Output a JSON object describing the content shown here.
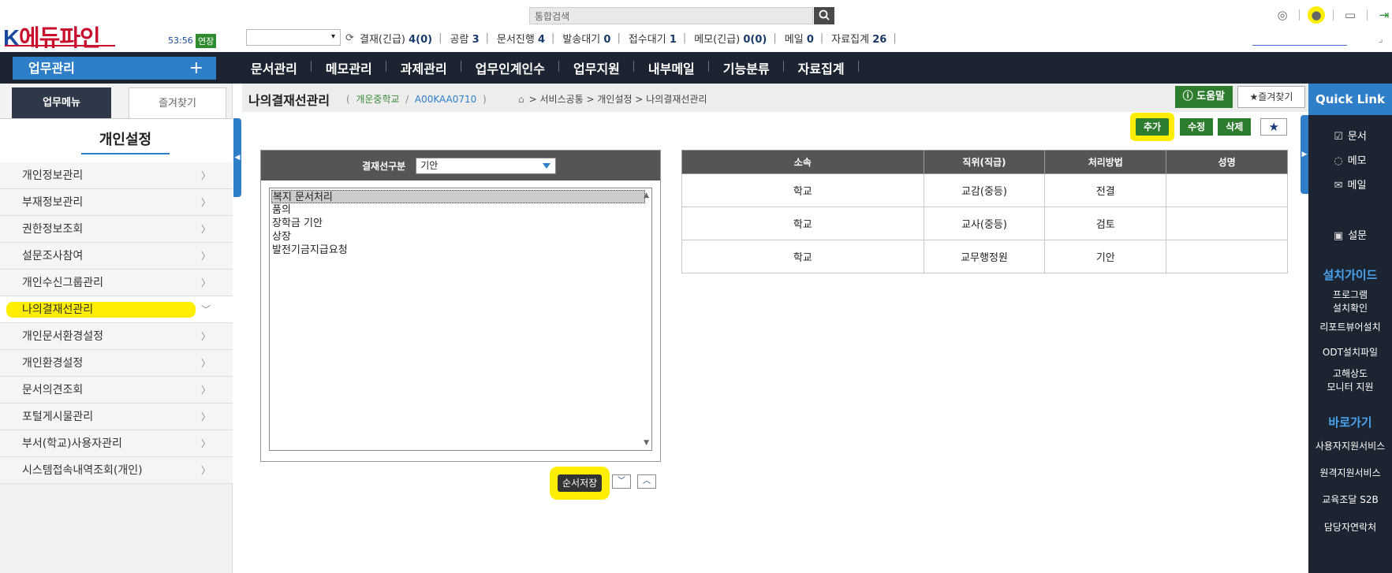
{
  "header": {
    "logo_k": "K",
    "logo_rest": "에듀파인",
    "timer": "53:56",
    "extend_label": "연장",
    "search_placeholder": "통합검색",
    "status": [
      {
        "label": "결재(긴급)",
        "value": "4(0)"
      },
      {
        "label": "공람",
        "value": "3"
      },
      {
        "label": "문서진행",
        "value": "4"
      },
      {
        "label": "발송대기",
        "value": "0"
      },
      {
        "label": "접수대기",
        "value": "1"
      },
      {
        "label": "메모(긴급)",
        "value": "0(0)"
      },
      {
        "label": "메일",
        "value": "0"
      },
      {
        "label": "자료집계",
        "value": "26"
      }
    ]
  },
  "navbar": {
    "work_label": "업무관리",
    "plus": "+",
    "items": [
      "문서관리",
      "메모관리",
      "과제관리",
      "업무인계인수",
      "업무지원",
      "내부메일",
      "기능분류",
      "자료집계"
    ]
  },
  "sidebar": {
    "tab_menu": "업무메뉴",
    "tab_fav": "즐겨찾기",
    "title": "개인설정",
    "items": [
      "개인정보관리",
      "부재정보관리",
      "권한정보조회",
      "설문조사참여",
      "개인수신그룹관리",
      "나의결재선관리",
      "개인문서환경설정",
      "개인환경설정",
      "문서의견조회",
      "포털게시물관리",
      "부서(학교)사용자관리",
      "시스템접속내역조회(개인)"
    ],
    "active_index": 5
  },
  "content": {
    "page_title": "나의결재선관리",
    "school": "개운중학교",
    "slash": "/",
    "code": "A00KAA0710",
    "paren_open": "(",
    "paren_close": ")",
    "breadcrumb": "> 서비스공통 > 개인설정 > 나의결재선관리",
    "help_label": "도움말",
    "fav_label": "즐겨찾기",
    "actions": {
      "add": "추가",
      "edit": "수정",
      "delete": "삭제"
    },
    "left_panel": {
      "label": "결재선구분",
      "selected": "기안",
      "options": [
        "복지 문서처리",
        "품의",
        "장학금 기안",
        "상장",
        "발전기금지급요청"
      ],
      "selected_option_index": 0,
      "order_save": "순서저장"
    },
    "table": {
      "columns": [
        "소속",
        "직위(직급)",
        "처리방법",
        "성명"
      ],
      "rows": [
        [
          "학교",
          "교감(중등)",
          "전결",
          ""
        ],
        [
          "학교",
          "교사(중등)",
          "검토",
          ""
        ],
        [
          "학교",
          "교무행정원",
          "기안",
          ""
        ]
      ]
    }
  },
  "quick_link": {
    "title": "Quick Link",
    "items": [
      "문서",
      "메모",
      "메일",
      "설문"
    ],
    "install_title": "설치가이드",
    "install_items": [
      "프로그램\n설치확인",
      "리포트뷰어설치",
      "ODT설치파일",
      "고해상도\n모니터 지원"
    ],
    "shortcut_title": "바로가기",
    "shortcut_items": [
      "사용자지원서비스",
      "원격지원서비스",
      "교육조달 S2B",
      "담당자연락처"
    ]
  },
  "colors": {
    "accent_blue": "#2f7fc8",
    "nav_dark": "#1b2430",
    "green": "#2e7d2e",
    "highlight": "#ffee00"
  }
}
